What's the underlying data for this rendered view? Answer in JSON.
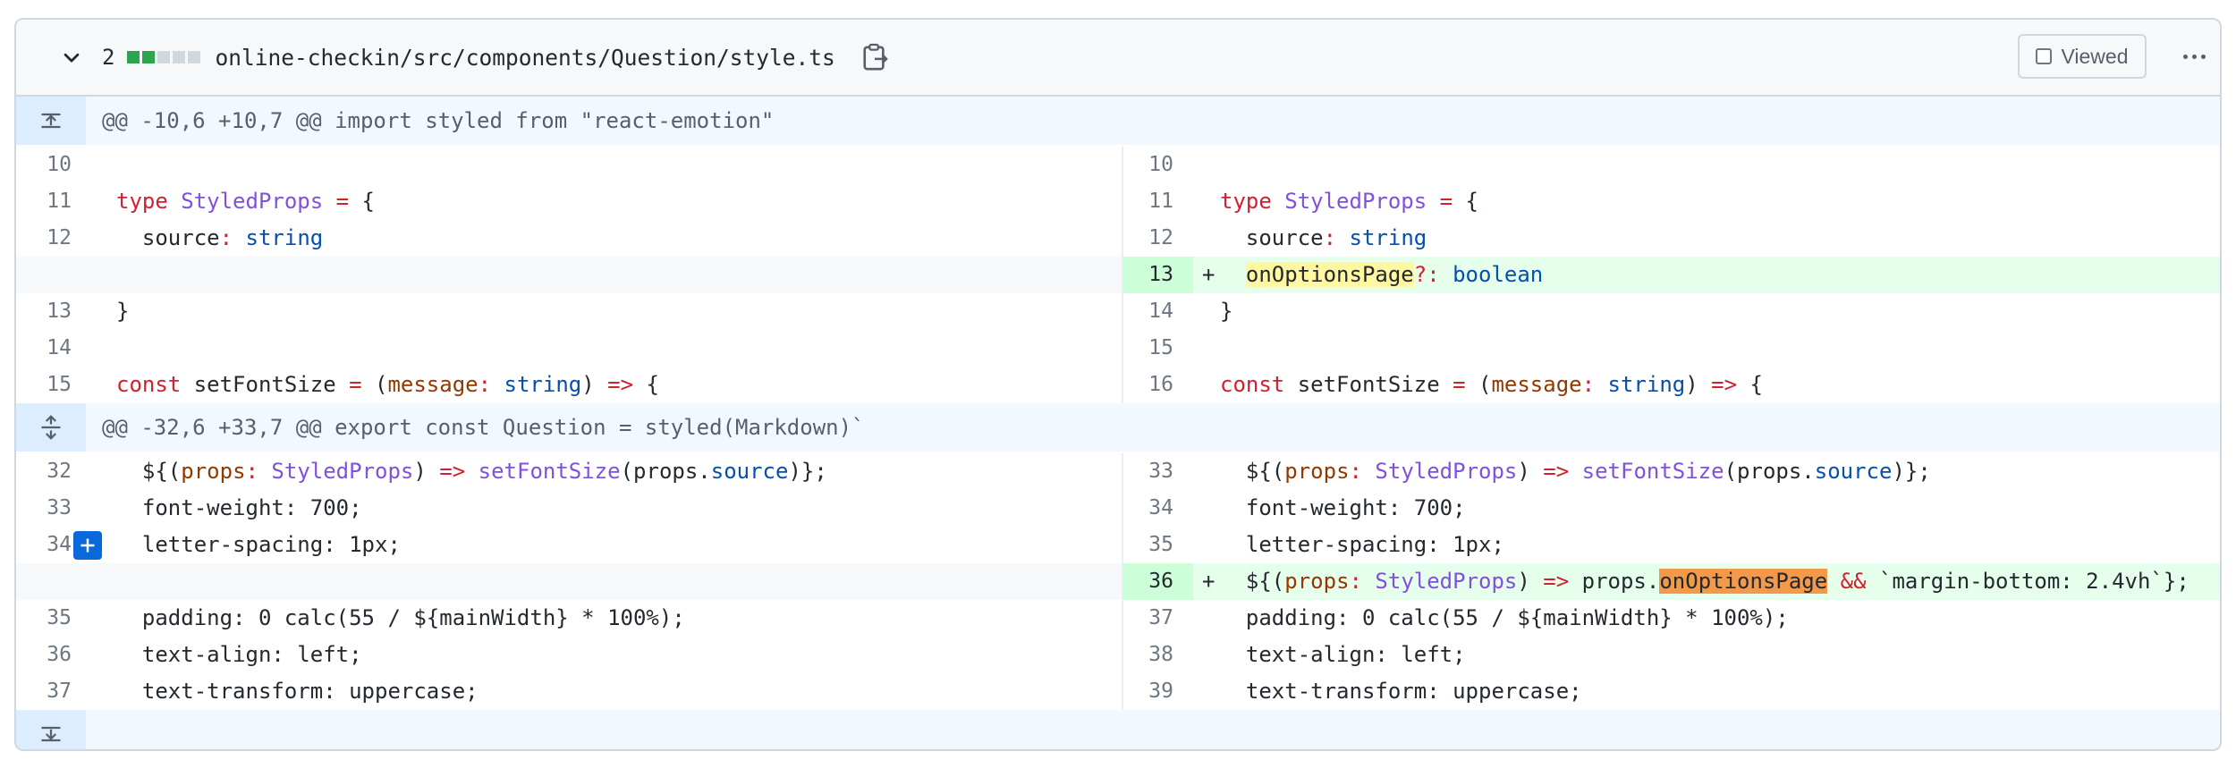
{
  "file": {
    "changes_count": "2",
    "path": "online-checkin/src/components/Question/style.ts",
    "viewed_label": "Viewed",
    "diffstat_colors": [
      "#2da44e",
      "#2da44e",
      "#d0d7de",
      "#d0d7de",
      "#d0d7de"
    ]
  },
  "hunks": [
    {
      "header": "@@ -10,6 +10,7 @@ import styled from \"react-emotion\""
    },
    {
      "header": "@@ -32,6 +33,7 @@ export const Question = styled(Markdown)`"
    }
  ],
  "hunk1": {
    "left_nums": [
      "10",
      "11",
      "12",
      "13",
      "14",
      "15"
    ],
    "right_nums": [
      "10",
      "11",
      "12",
      "13",
      "14",
      "15",
      "16"
    ]
  },
  "hunk2": {
    "left_nums": [
      "32",
      "33",
      "34",
      "35",
      "36",
      "37"
    ],
    "right_nums": [
      "33",
      "34",
      "35",
      "36",
      "37",
      "38",
      "39"
    ]
  },
  "code": {
    "type_kw": "type",
    "styled_props": "StyledProps",
    "eq_brace": " = {",
    "source": "source",
    "colon": ":",
    "string": "string",
    "close_brace": "}",
    "const": "const",
    "set_font_size": " setFontSize ",
    "eq": "=",
    "open_paren": " (",
    "message": "message",
    "arrow": "=>",
    "on_options_page": "onOptionsPage",
    "optional_colon": "?:",
    "boolean": "boolean",
    "plus": "+",
    "dollar_open": "${(",
    "props": "props",
    "paren_close": ") ",
    "set_font_size_fn": "setFontSize",
    "props_dot": "(props.",
    "source_end": ")};",
    "font_weight": "font-weight: 700;",
    "letter_spacing": "letter-spacing: 1px;",
    "props_dot2": " props.",
    "and": "&&",
    "margin_bottom": " `margin-bottom: 2.4vh`};",
    "padding": "padding: 0 calc(55 / ${mainWidth} * 100%);",
    "text_align": "text-align: left;",
    "text_transform": "text-transform: uppercase;"
  }
}
